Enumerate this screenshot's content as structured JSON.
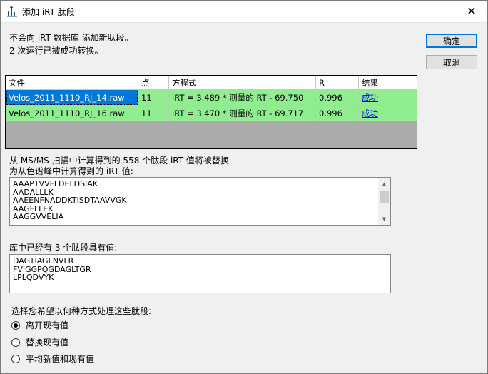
{
  "window": {
    "title": "添加 iRT 肽段",
    "close_glyph": "✕"
  },
  "message": {
    "line1": "不会向 iRT 数据库 添加新肽段。",
    "line2": "2 次运行已被成功转换。"
  },
  "buttons": {
    "ok": "确定",
    "cancel": "取消"
  },
  "grid": {
    "columns": [
      "文件",
      "点",
      "方程式",
      "R",
      "结果"
    ],
    "rows": [
      {
        "file": "Velos_2011_1110_RJ_14.raw",
        "points": "11",
        "equation": "iRT = 3.489 * 测量的 RT - 69.750",
        "r": "0.996",
        "result": "成功"
      },
      {
        "file": "Velos_2011_1110_RJ_16.raw",
        "points": "11",
        "equation": "iRT = 3.470 * 测量的 RT - 69.717",
        "r": "0.996",
        "result": "成功"
      }
    ],
    "row_color": "#90ee90",
    "selected_color": "#0078d7"
  },
  "replace_section": {
    "label_line1": "从 MS/MS 扫描中计算得到的 558 个肽段 iRT 值将被替换",
    "label_line2": "为从色谱峰中计算得到的 iRT 值:",
    "items": [
      "AAAPTVVFLDELDSIAK",
      "AADALLLK",
      "AAEENFNADDKTISDTAAVVGK",
      "AAGFLLEK",
      "AAGGVVELIA"
    ]
  },
  "existing_section": {
    "label": "库中已经有 3 个肽段具有值:",
    "items": [
      "DAGTIAGLNVLR",
      "FVIGGPQGDAGLTGR",
      "LPLQDVYK"
    ]
  },
  "options": {
    "label": "选择您希望以何种方式处理这些肽段:",
    "choices": [
      {
        "label": "离开现有值",
        "checked": true
      },
      {
        "label": "替换现有值",
        "checked": false
      },
      {
        "label": "平均新值和现有值",
        "checked": false
      }
    ]
  }
}
